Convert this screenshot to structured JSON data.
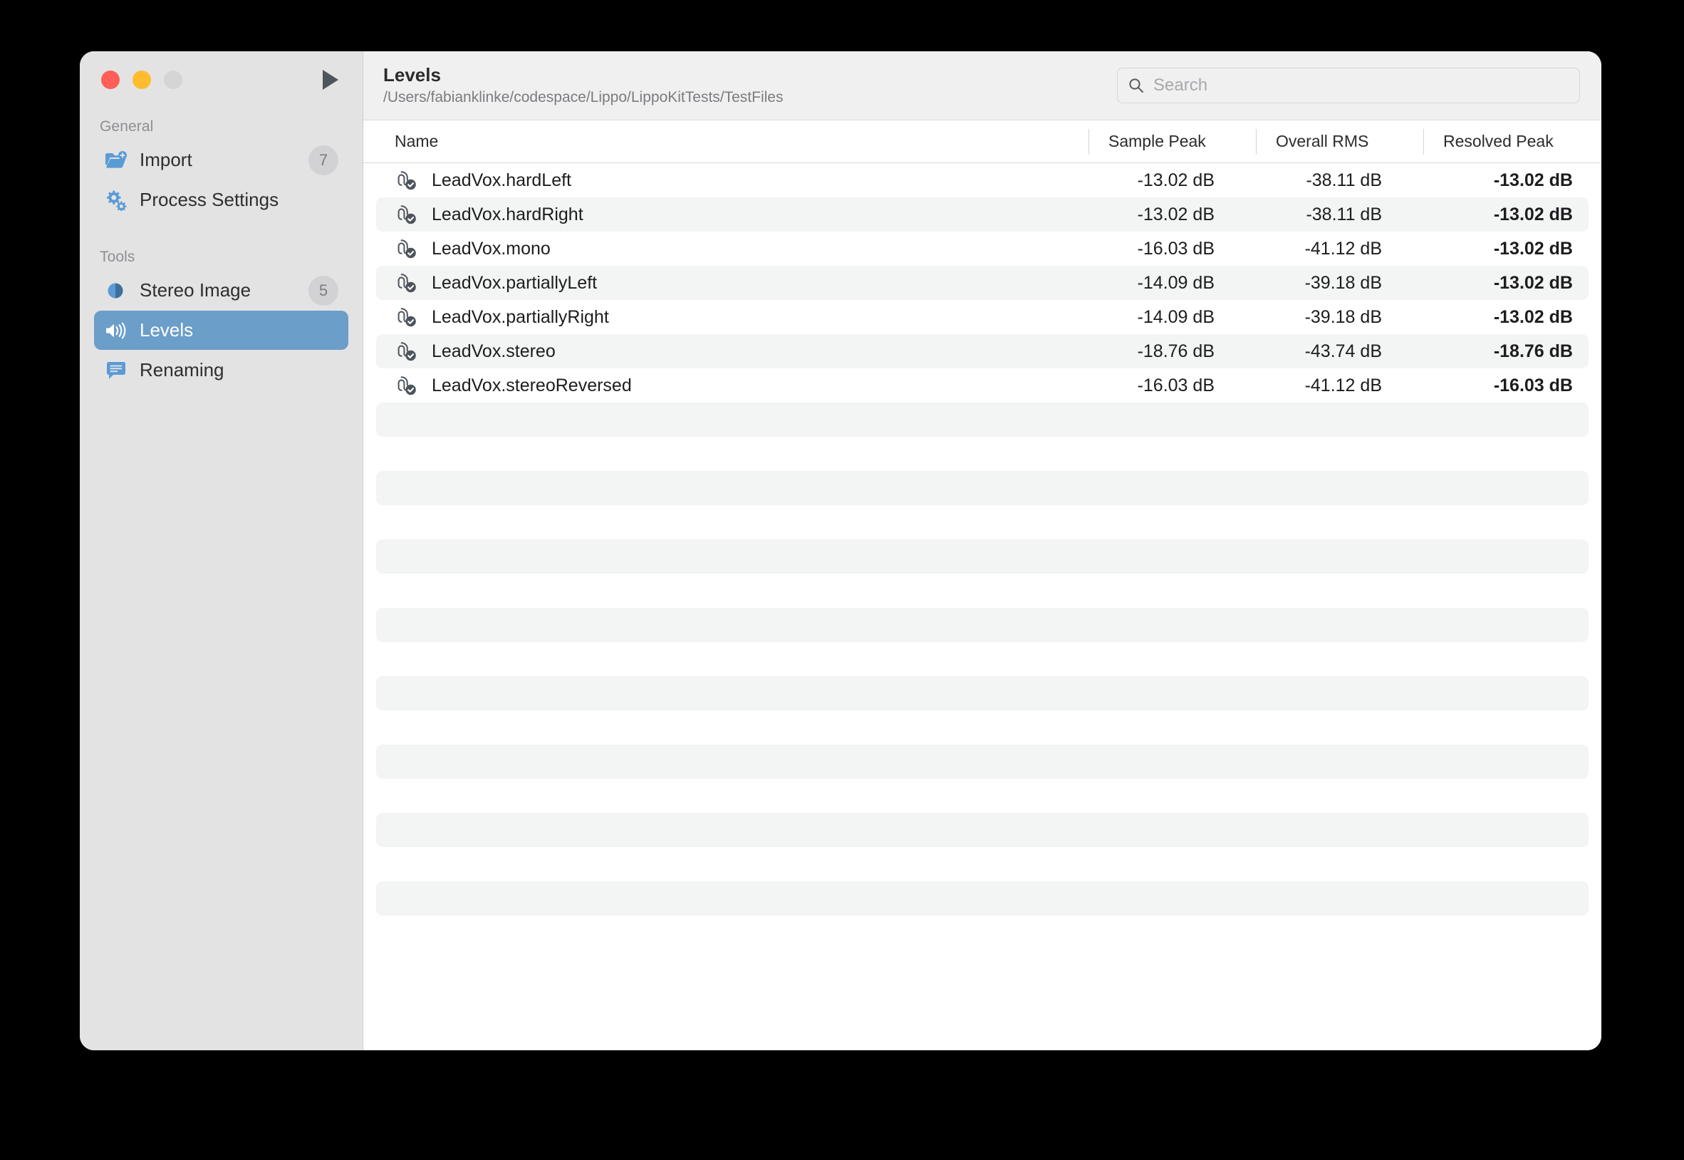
{
  "window": {
    "traffic_lights": [
      "close",
      "minimize",
      "zoom"
    ],
    "play_button": "play-icon",
    "accent_color": "#6b9ec9"
  },
  "sidebar": {
    "sections": [
      {
        "label": "General",
        "items": [
          {
            "label": "Import",
            "icon": "folder-add-icon",
            "badge": "7",
            "selected": false
          },
          {
            "label": "Process Settings",
            "icon": "gears-icon",
            "badge": "",
            "selected": false
          }
        ]
      },
      {
        "label": "Tools",
        "items": [
          {
            "label": "Stereo Image",
            "icon": "stereo-circle-icon",
            "badge": "5",
            "selected": false
          },
          {
            "label": "Levels",
            "icon": "speaker-waves-icon",
            "badge": "",
            "selected": true
          },
          {
            "label": "Renaming",
            "icon": "text-bubble-icon",
            "badge": "",
            "selected": false
          }
        ]
      }
    ]
  },
  "header": {
    "title": "Levels",
    "path": "/Users/fabianklinke/codespace/Lippo/LippoKitTests/TestFiles"
  },
  "search": {
    "placeholder": "Search",
    "value": "",
    "icon": "search-icon"
  },
  "table": {
    "columns": [
      {
        "key": "name",
        "label": "Name"
      },
      {
        "key": "sample_peak",
        "label": "Sample Peak"
      },
      {
        "key": "overall_rms",
        "label": "Overall RMS"
      },
      {
        "key": "resolved_peak",
        "label": "Resolved Peak"
      }
    ],
    "rows": [
      {
        "icon": "audio-file-checked-icon",
        "name": "LeadVox.hardLeft",
        "sample_peak": "-13.02 dB",
        "overall_rms": "-38.11 dB",
        "resolved_peak": "-13.02 dB"
      },
      {
        "icon": "audio-file-checked-icon",
        "name": "LeadVox.hardRight",
        "sample_peak": "-13.02 dB",
        "overall_rms": "-38.11 dB",
        "resolved_peak": "-13.02 dB"
      },
      {
        "icon": "audio-file-checked-icon",
        "name": "LeadVox.mono",
        "sample_peak": "-16.03 dB",
        "overall_rms": "-41.12 dB",
        "resolved_peak": "-13.02 dB"
      },
      {
        "icon": "audio-file-checked-icon",
        "name": "LeadVox.partiallyLeft",
        "sample_peak": "-14.09 dB",
        "overall_rms": "-39.18 dB",
        "resolved_peak": "-13.02 dB"
      },
      {
        "icon": "audio-file-checked-icon",
        "name": "LeadVox.partiallyRight",
        "sample_peak": "-14.09 dB",
        "overall_rms": "-39.18 dB",
        "resolved_peak": "-13.02 dB"
      },
      {
        "icon": "audio-file-checked-icon",
        "name": "LeadVox.stereo",
        "sample_peak": "-18.76 dB",
        "overall_rms": "-43.74 dB",
        "resolved_peak": "-18.76 dB"
      },
      {
        "icon": "audio-file-checked-icon",
        "name": "LeadVox.stereoReversed",
        "sample_peak": "-16.03 dB",
        "overall_rms": "-41.12 dB",
        "resolved_peak": "-16.03 dB"
      }
    ],
    "empty_row_count": 16
  }
}
